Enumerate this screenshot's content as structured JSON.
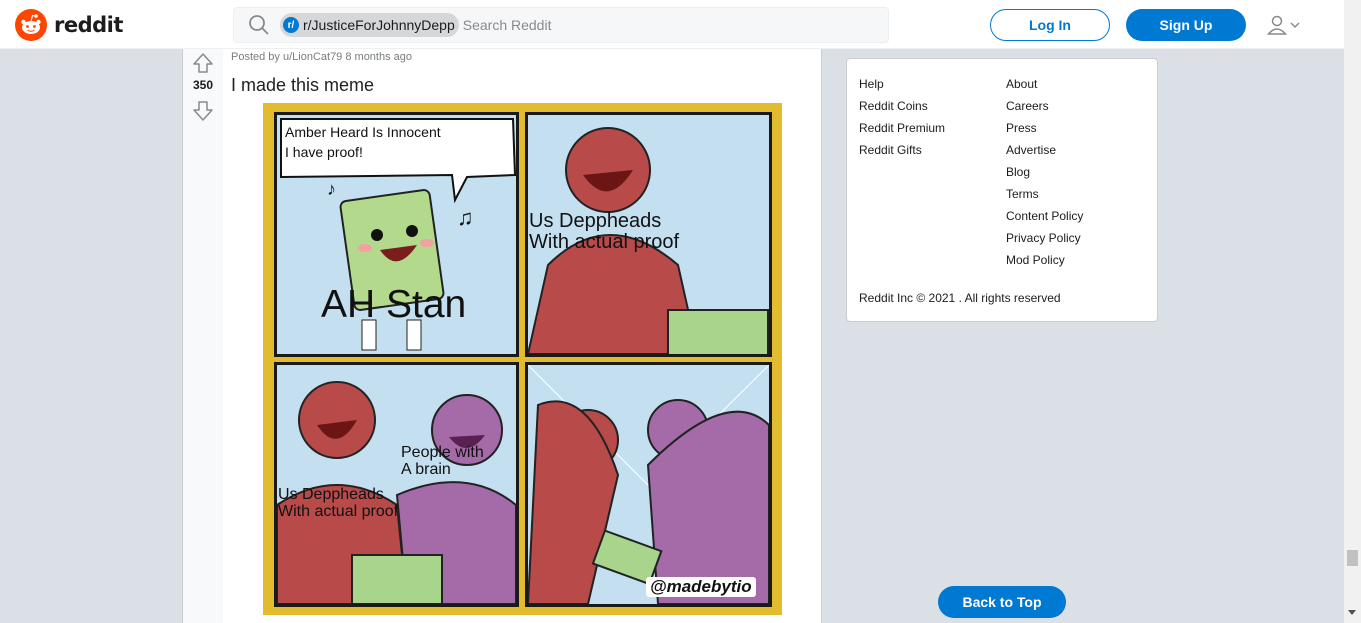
{
  "header": {
    "logo_text": "reddit",
    "search": {
      "chip_prefix": "r/",
      "chip_label": "r/JusticeForJohnnyDepp",
      "placeholder": "Search Reddit"
    },
    "login_label": "Log In",
    "signup_label": "Sign Up"
  },
  "post": {
    "vote_count": "350",
    "meta": "Posted by u/LionCat79 8 months ago",
    "title": "I made this meme",
    "image_text": {
      "bubble": "Amber Heard Is Innocent\nI have proof!",
      "ah_stan": "AH Stan",
      "deppheads_top": "Us Deppheads\nWith actual proof",
      "brain": "People with\nA brain",
      "deppheads_bottom": "Us Deppheads\nWith actual proof",
      "watermark": "@madebytio"
    }
  },
  "sidebar": {
    "links_left": [
      "Help",
      "Reddit Coins",
      "Reddit Premium",
      "Reddit Gifts"
    ],
    "links_right": [
      "About",
      "Careers",
      "Press",
      "Advertise",
      "Blog",
      "Terms",
      "Content Policy",
      "Privacy Policy",
      "Mod Policy"
    ],
    "copyright": "Reddit Inc © 2021 . All rights reserved"
  },
  "back_to_top_label": "Back to Top",
  "colors": {
    "brand": "#ff4500",
    "accent": "#0079d3",
    "background": "#dae0e6",
    "meme_border": "#e2bb2e"
  }
}
